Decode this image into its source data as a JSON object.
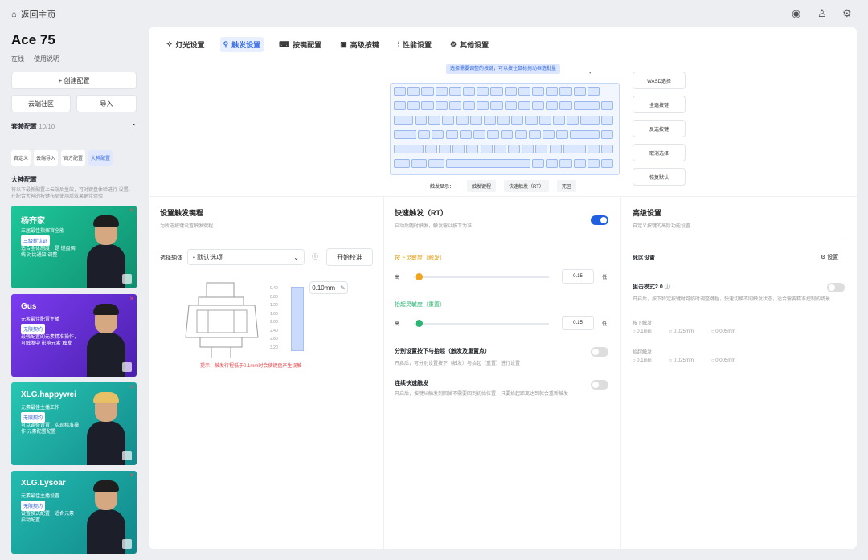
{
  "nav": {
    "back": "返回主页"
  },
  "device": {
    "name": "Ace 75",
    "status": "在线",
    "manual": "使用说明",
    "new_config": "+ 创建配置",
    "cloud": "云端社区",
    "import": "导入"
  },
  "config": {
    "title": "套装配置",
    "count": "10/10",
    "tabs": [
      "自定义",
      "云端导入",
      "官方配置",
      "大神配置"
    ],
    "big_title": "大神配置",
    "big_desc": "将以下最新配置上云端后生效，可对键盘体验进行 设置。在配合大神的按键布局使用后效果更佳体验"
  },
  "pros": [
    {
      "name": "杨齐家",
      "tag": "三届最佳指挥官全能",
      "badge": "三级新认证",
      "desc": "适合全体制度，是 键盘调 统 对比通知 调整"
    },
    {
      "name": "Gus",
      "tag": "元素最佳配置主播",
      "badge": "无限契约",
      "desc": "最强配置的元素精准操作，可触发中 影响元素 触发"
    },
    {
      "name": "XLG.happywei",
      "tag": "元素最佳主播工作",
      "badge": "无限契约",
      "desc": "可以调整设置，实现精准操作 元素配置配置"
    },
    {
      "name": "XLG.Lysoar",
      "tag": "元素最佳主播设置",
      "badge": "无限契约",
      "desc": "设置模式配置，适合元素 启动配置"
    }
  ],
  "tabs": [
    "灯光设置",
    "触发设置",
    "按键配置",
    "高级按键",
    "性能设置",
    "其他设置"
  ],
  "keyboard": {
    "hint": "选择需要调整的按键，可以按住鼠标拖动框选批量",
    "legend": [
      "触发显示：",
      "触发键程",
      "快速触发（RT）",
      "死区"
    ],
    "right_buttons": [
      "WASD选择",
      "全选按键",
      "反选按键",
      "取消选择",
      "恢复默认"
    ]
  },
  "trigger": {
    "title": "设置触发键程",
    "desc": "为所选按键设置触发键程",
    "select_label": "选择轴体",
    "select_value": "• 默认选项",
    "calibrate": "开始校准",
    "travel": "0.10mm",
    "warn": "提示：触发行程低于0.1mm时会使键盘产生误触",
    "scale": [
      "0.40",
      "0.80",
      "1.20",
      "1.60",
      "2.00",
      "2.40",
      "2.80",
      "3.20"
    ]
  },
  "rt": {
    "title": "快速触发（RT）",
    "desc": "启动后随时触发，触发需以按下为准",
    "press_label": "按下灵敏度（触发）",
    "release_label": "抬起灵敏度（重置）",
    "high": "高",
    "low": "低",
    "press_val": "0.15",
    "release_val": "0.15",
    "sep_title": "分别设置按下与抬起（触发及重置点）",
    "sep_desc": "开启后，可分别设置按下（触发）与抬起（重置）进行设置",
    "cont_title": "连续快速触发",
    "cont_desc": "开启后，按键从触发到回弹不需要回到初始位置，只要抬起距离达到就会重新触发"
  },
  "adv": {
    "title": "高级设置",
    "desc": "自定义按键的高阶功能设置",
    "dz_title": "死区设置",
    "dz_set": "设置",
    "mode": "狙击模式2.0",
    "mode_desc": "开启后，按下特定按键时可临时调整键程，快速切换不同触发状态，适合需要精准控制的场景",
    "press": "按下触发",
    "release": "抬起触发",
    "opts": [
      "0.1mm",
      "0.025mm",
      "0.005mm"
    ]
  },
  "colors": {
    "accent": "#1f5fe0",
    "card1": "#16b98e",
    "card2": "#6a2fe0",
    "card3": "#22b9a5"
  }
}
